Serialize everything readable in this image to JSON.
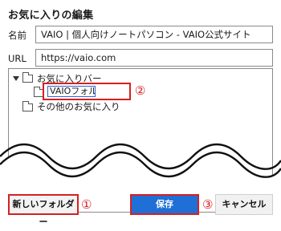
{
  "dialog": {
    "title": "お気に入りの編集"
  },
  "name_field": {
    "label": "名前",
    "value": "VAIO | 個人向けノートパソコン - VAIO公式サイト"
  },
  "url_field": {
    "label": "URL",
    "value": "https://vaio.com"
  },
  "tree": {
    "items": [
      {
        "label": "お気に入りバー",
        "expanded": true
      },
      {
        "label": "VAIOフォルダ",
        "editing": true
      },
      {
        "label": "その他のお気に入り"
      }
    ]
  },
  "callouts": {
    "one": "①",
    "two": "②",
    "three": "③"
  },
  "buttons": {
    "new_folder": "新しいフォルダー",
    "save": "保存",
    "cancel": "キャンセル"
  },
  "colors": {
    "accent": "#1f6fd6",
    "highlight": "#d62020"
  }
}
